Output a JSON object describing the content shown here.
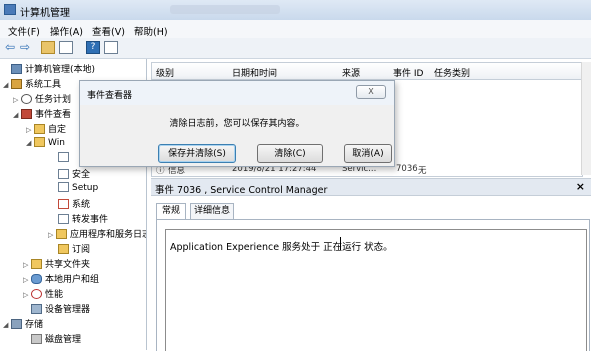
{
  "window": {
    "title": "计算机管理"
  },
  "menu": [
    "文件(F)",
    "操作(A)",
    "查看(V)",
    "帮助(H)"
  ],
  "tree": [
    {
      "label": "计算机管理(本地)",
      "icon": "computer-icon",
      "expander": ""
    },
    {
      "label": "系统工具",
      "icon": "tools-icon",
      "expander": "◢"
    },
    {
      "label": "任务计划",
      "icon": "clock-icon",
      "expander": "▷"
    },
    {
      "label": "事件查看",
      "icon": "event-viewer-icon",
      "expander": "◢"
    },
    {
      "label": "自定",
      "icon": "folder-icon",
      "expander": "▷"
    },
    {
      "label": "Win",
      "icon": "folder-icon",
      "expander": "◢"
    },
    {
      "label": "",
      "icon": "log-icon",
      "expander": ""
    },
    {
      "label": "安全",
      "icon": "log-icon",
      "expander": ""
    },
    {
      "label": "Setup",
      "icon": "log-icon",
      "expander": ""
    },
    {
      "label": "系统",
      "icon": "log-icon",
      "expander": ""
    },
    {
      "label": "转发事件",
      "icon": "log-icon",
      "expander": ""
    },
    {
      "label": "应用程序和服务日志",
      "icon": "folder-icon",
      "expander": "▷"
    },
    {
      "label": "订阅",
      "icon": "subscription-icon",
      "expander": ""
    },
    {
      "label": "共享文件夹",
      "icon": "shared-folder-icon",
      "expander": "▷"
    },
    {
      "label": "本地用户和组",
      "icon": "users-icon",
      "expander": "▷"
    },
    {
      "label": "性能",
      "icon": "performance-icon",
      "expander": "▷"
    },
    {
      "label": "设备管理器",
      "icon": "device-manager-icon",
      "expander": ""
    },
    {
      "label": "存储",
      "icon": "storage-icon",
      "expander": "◢"
    },
    {
      "label": "磁盘管理",
      "icon": "disk-icon",
      "expander": ""
    }
  ],
  "grid": {
    "columns": [
      "级别",
      "日期和时间",
      "来源",
      "事件 ID",
      "任务类别"
    ],
    "last_row": {
      "level": "信息",
      "datetime": "2019/8/21 17:27:44",
      "source": "Servic...",
      "event_id": "7036",
      "category": "无"
    }
  },
  "detail": {
    "header": "事件 7036 , Service Control Manager",
    "close": "×",
    "tabs": [
      "常规",
      "详细信息"
    ],
    "message": "Application Experience 服务处于 正在运行 状态。"
  },
  "dialog": {
    "title": "事件查看器",
    "close_label": "X",
    "info": "清除日志前，您可以保存其内容。",
    "buttons": [
      "保存并清除(S)",
      "清除(C)",
      "取消(A)"
    ]
  }
}
